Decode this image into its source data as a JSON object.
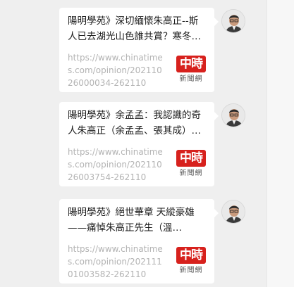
{
  "messages": [
    {
      "title": "陽明學苑》深切緬懷朱高正--斯人已去湖光山色誰共賞？寒冬…",
      "url": "https://www.chinatimes.com/opinion/20211026000034-262110",
      "source_logo": {
        "top": "中時",
        "bottom": "新聞網"
      }
    },
    {
      "title": "陽明學苑》余孟孟：我認識的奇人朱高正（余孟孟、張其成）…",
      "url": "https://www.chinatimes.com/opinion/20211026003754-262110",
      "source_logo": {
        "top": "中時",
        "bottom": "新聞網"
      }
    },
    {
      "title": "陽明學苑》絕世華章 天縱豪雄——痛悼朱高正先生（溫…",
      "url": "https://www.chinatimes.com/opinion/20211101003582-262110",
      "source_logo": {
        "top": "中時",
        "bottom": "新聞網"
      }
    }
  ],
  "colors": {
    "background": "#efefef",
    "bubble": "#ffffff",
    "url_text": "#b3b3b3",
    "logo_red": "#d7211d"
  },
  "icons": {
    "avatar": "user-avatar-icon",
    "logo": "chinatimes-logo-icon"
  }
}
